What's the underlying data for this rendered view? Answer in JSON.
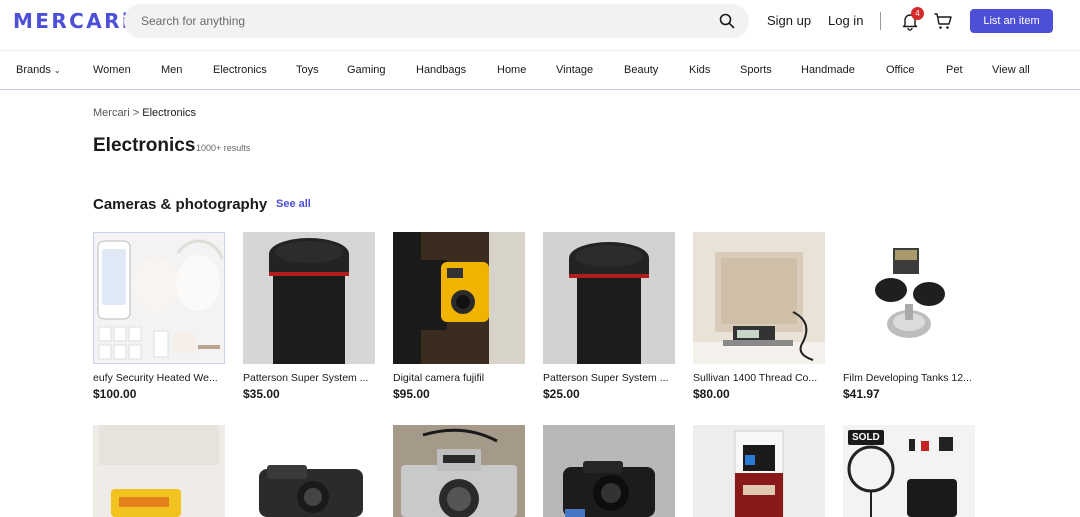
{
  "header": {
    "logo": "MERCARi",
    "search_placeholder": "Search for anything",
    "sign_up": "Sign up",
    "log_in": "Log in",
    "notif_count": "4",
    "list_item": "List an item"
  },
  "categories": [
    "Brands",
    "Women",
    "Men",
    "Electronics",
    "Toys",
    "Gaming",
    "Handbags",
    "Home",
    "Vintage",
    "Beauty",
    "Kids",
    "Sports",
    "Handmade",
    "Office",
    "Pet",
    "View all"
  ],
  "breadcrumb": {
    "root": "Mercari",
    "sep": ">",
    "current": "Electronics"
  },
  "page": {
    "title": "Electronics",
    "results": "1000+ results"
  },
  "section": {
    "title": "Cameras & photography",
    "see_all": "See all"
  },
  "products": [
    {
      "name": "eufy Security Heated We...",
      "price": "$100.00"
    },
    {
      "name": "Patterson Super System ...",
      "price": "$35.00"
    },
    {
      "name": "Digital camera fujifil",
      "price": "$95.00"
    },
    {
      "name": "Patterson Super System ...",
      "price": "$25.00"
    },
    {
      "name": "Sullivan 1400 Thread Co...",
      "price": "$80.00"
    },
    {
      "name": "Film Developing Tanks 12...",
      "price": "$41.97"
    }
  ],
  "row2": {
    "sold_label": "SOLD"
  },
  "colors": {
    "brand": "#4d4fd6",
    "badge": "#d62929"
  }
}
